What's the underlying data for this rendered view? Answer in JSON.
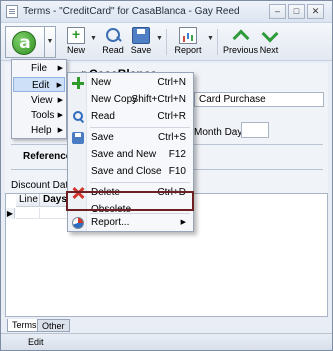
{
  "window": {
    "title": "Terms - \"CreditCard\" for CasaBlanca - Gay Reed",
    "buttons": {
      "minimize": "–",
      "maximize": "□",
      "close": "✕"
    }
  },
  "toolbar": {
    "new_label": "New",
    "read_label": "Read",
    "save_label": "Save",
    "report_label": "Report",
    "previous_label": "Previous",
    "next_label": "Next",
    "dropdown_glyph": "▼"
  },
  "form": {
    "heading_partial": "r CasaBlanca",
    "description_value": "Card Purchase",
    "month_day_label": "Month Day:",
    "month_day_value": "",
    "references_label": "References:",
    "discount_dates_label": "Discount Dates",
    "grid_columns": [
      "Line",
      "Days"
    ],
    "row_marker": "▶"
  },
  "main_menu": {
    "items": [
      {
        "label": "File",
        "arrow": "▶"
      },
      {
        "label": "Edit",
        "arrow": "▶"
      },
      {
        "label": "View",
        "arrow": "▶"
      },
      {
        "label": "Tools",
        "arrow": "▶"
      },
      {
        "label": "Help",
        "arrow": "▶"
      }
    ]
  },
  "edit_menu": {
    "items": [
      {
        "label": "New",
        "shortcut": "Ctrl+N",
        "icon": "plus-icon"
      },
      {
        "label": "New Copy",
        "shortcut": "Shift+Ctrl+N",
        "icon": ""
      },
      {
        "label": "Read",
        "shortcut": "Ctrl+R",
        "icon": "search-icon"
      },
      {
        "label": "Save",
        "shortcut": "Ctrl+S",
        "icon": "disk-icon"
      },
      {
        "label": "Save and New",
        "shortcut": "F12",
        "icon": ""
      },
      {
        "label": "Save and Close",
        "shortcut": "F10",
        "icon": ""
      },
      {
        "label": "Delete",
        "shortcut": "Ctrl+D",
        "icon": "delete-icon"
      },
      {
        "label": "Obsolete",
        "shortcut": "",
        "icon": ""
      },
      {
        "label": "Report...",
        "shortcut": "",
        "icon": "pie-chart-icon",
        "arrow": "▶"
      }
    ],
    "highlight_color": "#6e1f24"
  },
  "tabs": [
    {
      "label": "Terms"
    },
    {
      "label": "Other"
    }
  ],
  "statusbar": {
    "text": "Edit"
  }
}
